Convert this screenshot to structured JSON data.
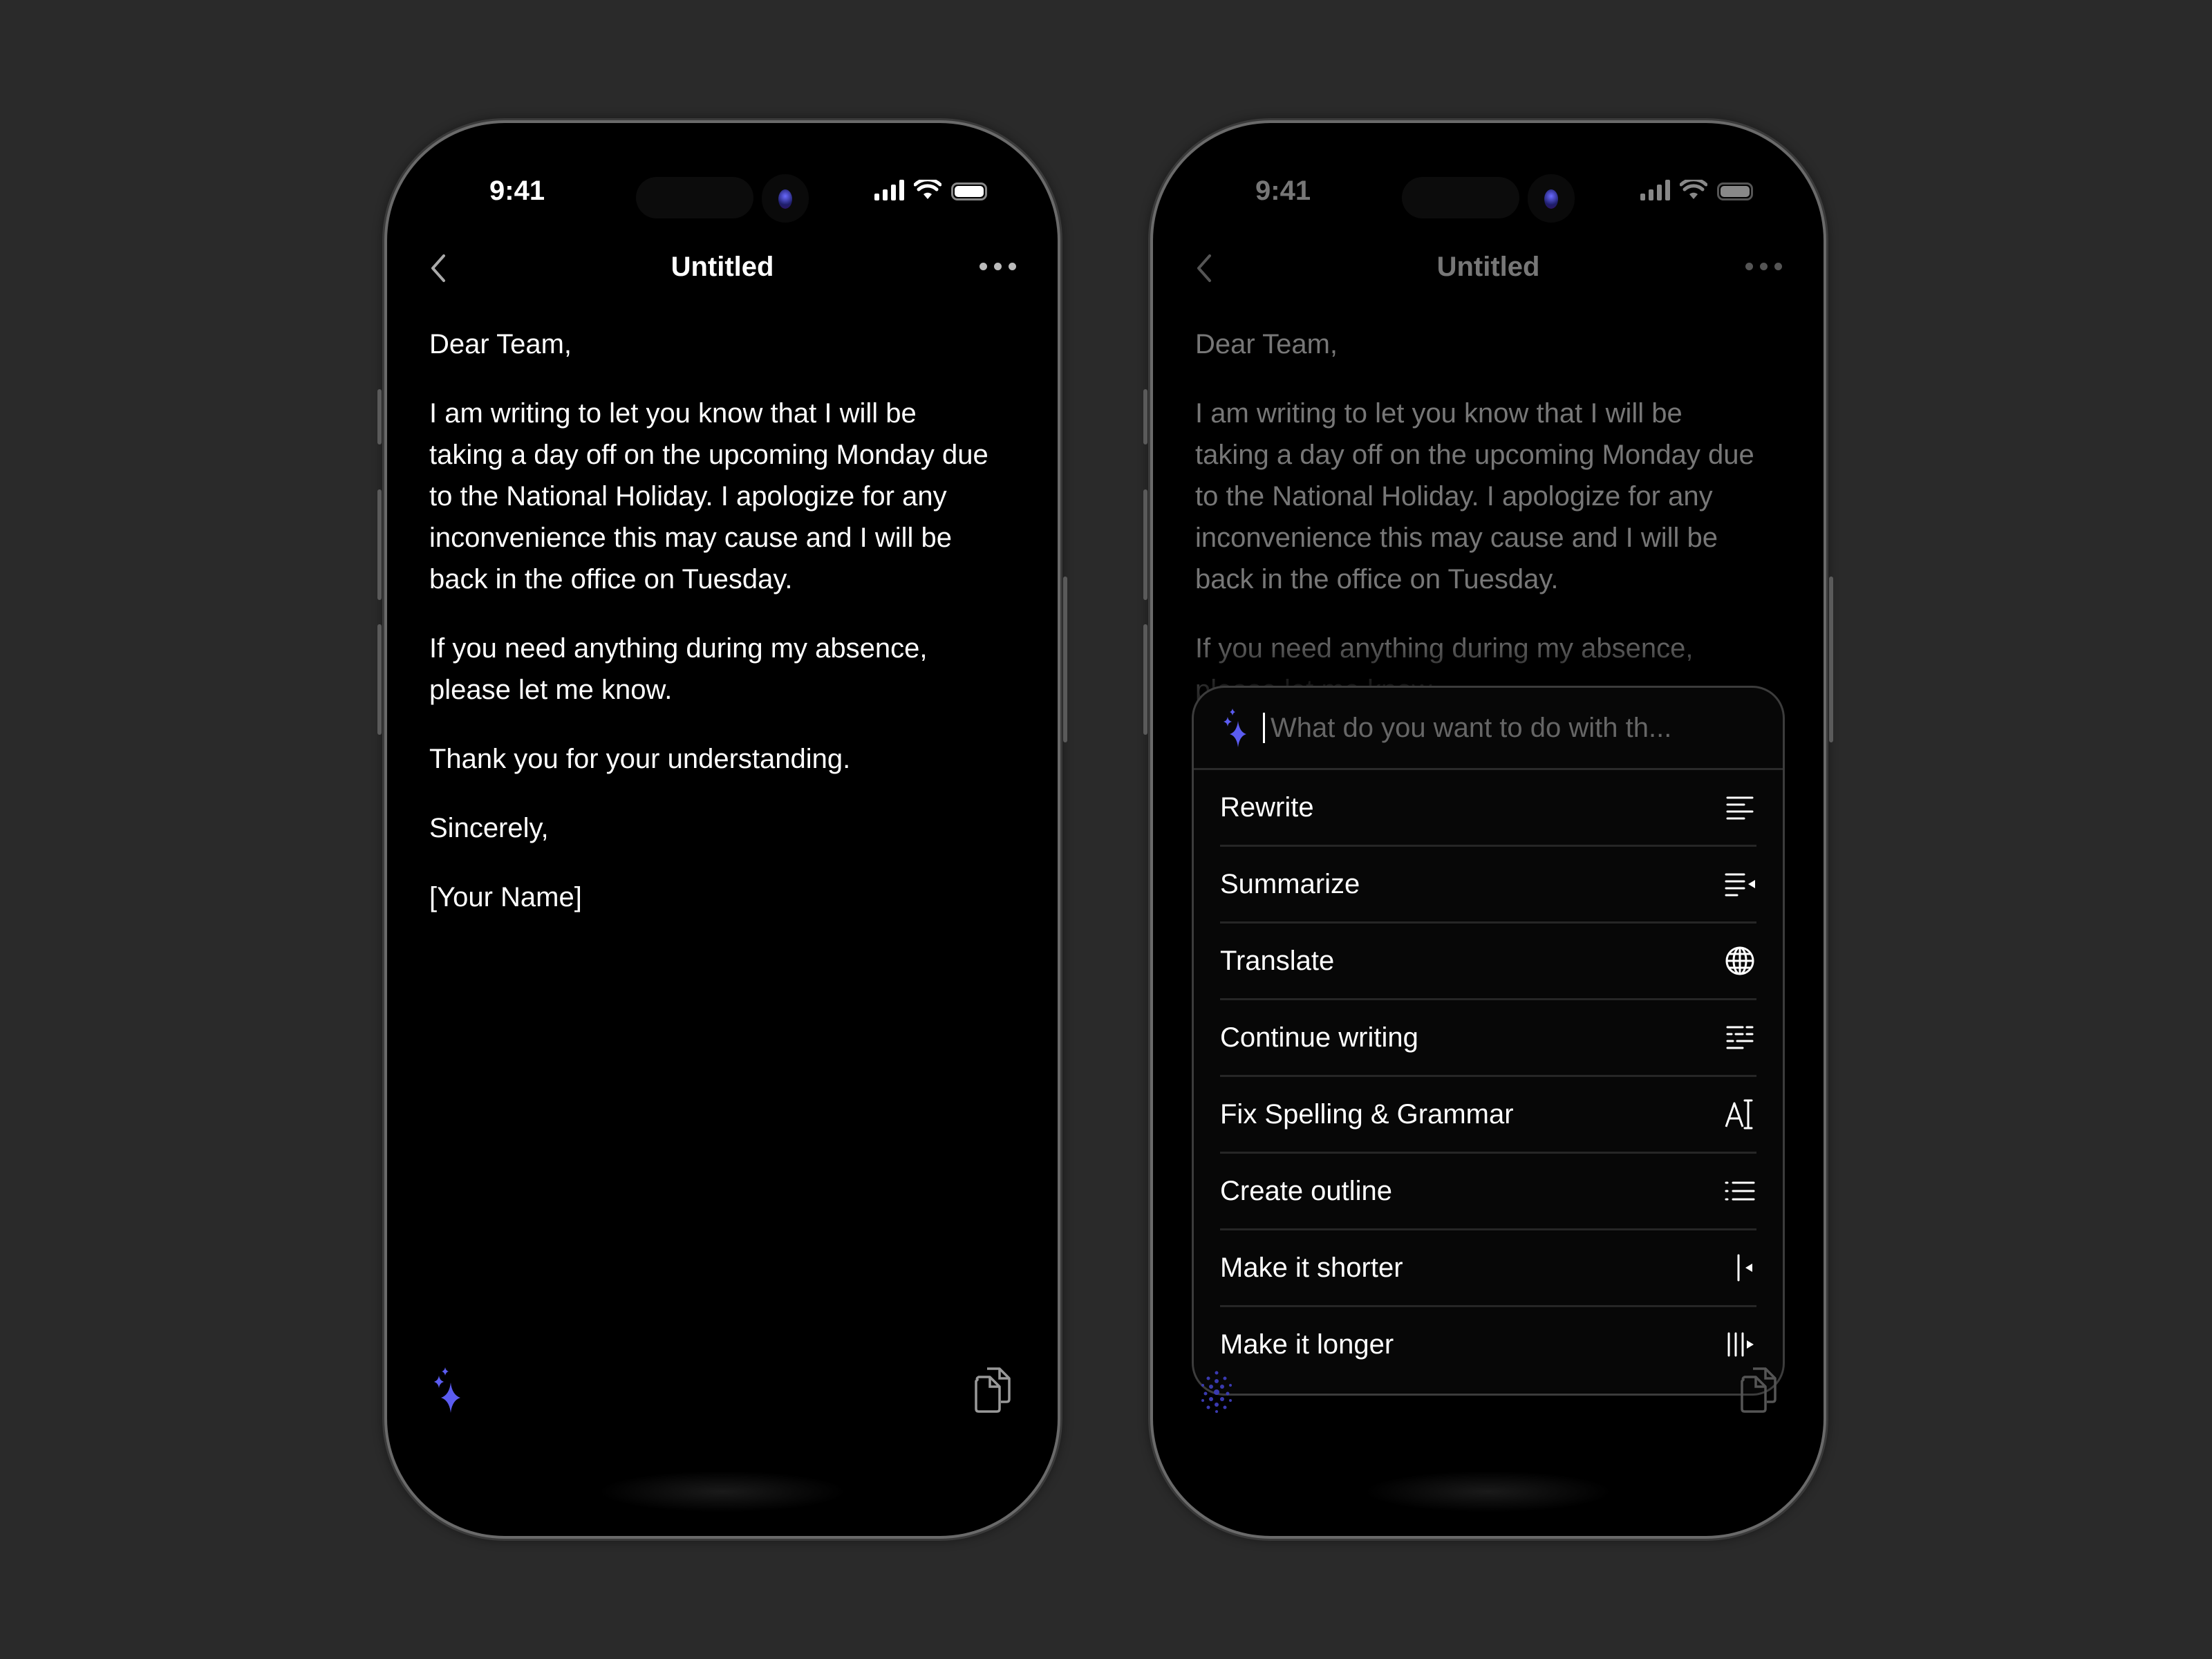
{
  "phones": [
    {
      "status": {
        "time": "9:41"
      },
      "nav": {
        "title": "Untitled",
        "back_icon": "chevron-left-icon",
        "more_icon": "ellipsis-icon"
      },
      "document": {
        "paragraphs": [
          "Dear Team,",
          "I am writing to let you know that I will be taking a day off on the upcoming Monday due to the National Holiday. I apologize for any inconvenience this may cause and I will be back in the office on Tuesday.",
          "If you need anything during my absence, please let me know.",
          "Thank you for your understanding.",
          "Sincerely,",
          "[Your Name]"
        ]
      },
      "toolbar": {
        "left_icon": "sparkles-icon",
        "right_icon": "copy-documents-icon"
      }
    },
    {
      "status": {
        "time": "9:41"
      },
      "nav": {
        "title": "Untitled",
        "back_icon": "chevron-left-icon",
        "more_icon": "ellipsis-icon"
      },
      "document": {
        "paragraphs": [
          "Dear Team,",
          "I am writing to let you know that I will be taking a day off on the upcoming Monday due to the National Holiday. I apologize for any inconvenience this may cause and I will be back in the office on Tuesday.",
          "If you need anything during my absence, please let me know."
        ]
      },
      "ai_menu": {
        "input_placeholder": "What do you want to do with th...",
        "input_value": "",
        "items": [
          {
            "label": "Rewrite",
            "icon": "align-left-icon"
          },
          {
            "label": "Summarize",
            "icon": "summarize-icon"
          },
          {
            "label": "Translate",
            "icon": "globe-icon"
          },
          {
            "label": "Continue writing",
            "icon": "continue-writing-icon"
          },
          {
            "label": "Fix Spelling & Grammar",
            "icon": "text-cursor-icon"
          },
          {
            "label": "Create outline",
            "icon": "list-icon"
          },
          {
            "label": "Make it shorter",
            "icon": "shorten-icon"
          },
          {
            "label": "Make it longer",
            "icon": "lengthen-icon"
          }
        ]
      },
      "toolbar": {
        "left_icon": "loading-dots-icon",
        "right_icon": "copy-documents-icon"
      }
    }
  ],
  "colors": {
    "accent": "#5b5cf0",
    "background": "#2a2a2a",
    "screen": "#000000"
  }
}
